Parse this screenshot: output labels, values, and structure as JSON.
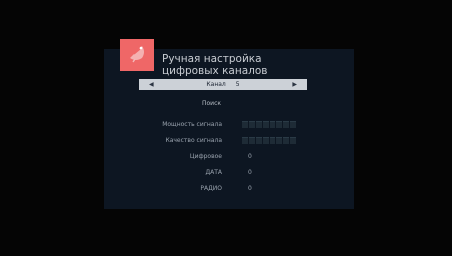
{
  "title": {
    "line1": "Ручная настройка",
    "line2": "цифровых каналов"
  },
  "logo_icon": "satellite-dish-icon",
  "colors": {
    "accent": "#ef6767",
    "panel": "#0d1622",
    "bar": "#ccd1d7"
  },
  "channel_bar": {
    "label": "Канал",
    "value": "5",
    "left_arrow": "◀",
    "right_arrow": "▶"
  },
  "search_label": "Поиск",
  "rows": [
    {
      "label": "Мощность сигнала",
      "value": "",
      "meter_level": 0.0
    },
    {
      "label": "Качество сигнала",
      "value": "",
      "meter_level": 0.0
    },
    {
      "label": "Цифровое",
      "value": "0"
    },
    {
      "label": "ДАТА",
      "value": "0"
    },
    {
      "label": "РАДИО",
      "value": "0"
    }
  ]
}
